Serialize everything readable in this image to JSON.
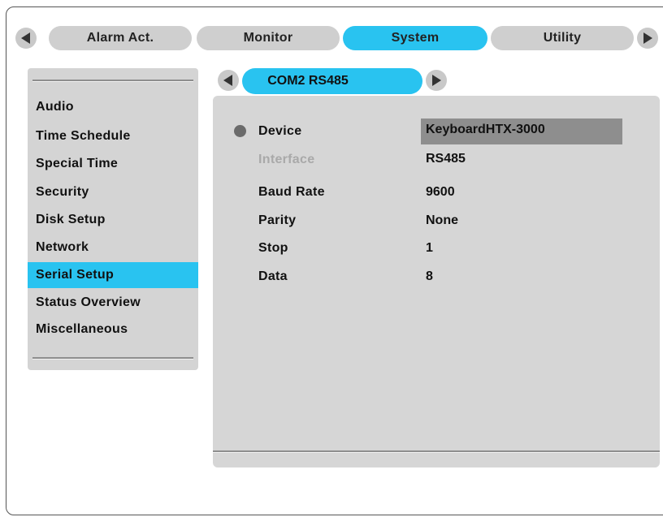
{
  "tabs": [
    {
      "label": "Alarm Act.",
      "active": false
    },
    {
      "label": "Monitor",
      "active": false
    },
    {
      "label": "System",
      "active": true
    },
    {
      "label": "Utility",
      "active": false
    }
  ],
  "sidebar": {
    "items": [
      {
        "label": "Audio"
      },
      {
        "label": "Time Schedule"
      },
      {
        "label": "Special Time"
      },
      {
        "label": "Security"
      },
      {
        "label": "Disk Setup"
      },
      {
        "label": "Network"
      },
      {
        "label": "Serial Setup",
        "active": true
      },
      {
        "label": "Status Overview"
      },
      {
        "label": "Miscellaneous"
      }
    ]
  },
  "subtab": {
    "label": "COM2 RS485"
  },
  "settings": {
    "device": {
      "label": "Device",
      "value": "KeyboardHTX-3000",
      "selected": true
    },
    "interface": {
      "label": "Interface",
      "value": "RS485",
      "disabled": true
    },
    "baud_rate": {
      "label": "Baud Rate",
      "value": "9600"
    },
    "parity": {
      "label": "Parity",
      "value": "None"
    },
    "stop": {
      "label": "Stop",
      "value": "1"
    },
    "data": {
      "label": "Data",
      "value": "8"
    }
  },
  "colors": {
    "accent": "#29c3f0",
    "tab_inactive": "#cfcfcf",
    "panel": "#d6d6d6",
    "selected_value_bg": "#8e8e8e"
  },
  "icons": {
    "left": "triangle-left-icon",
    "right": "triangle-right-icon",
    "bullet": "bullet-dot-icon"
  }
}
